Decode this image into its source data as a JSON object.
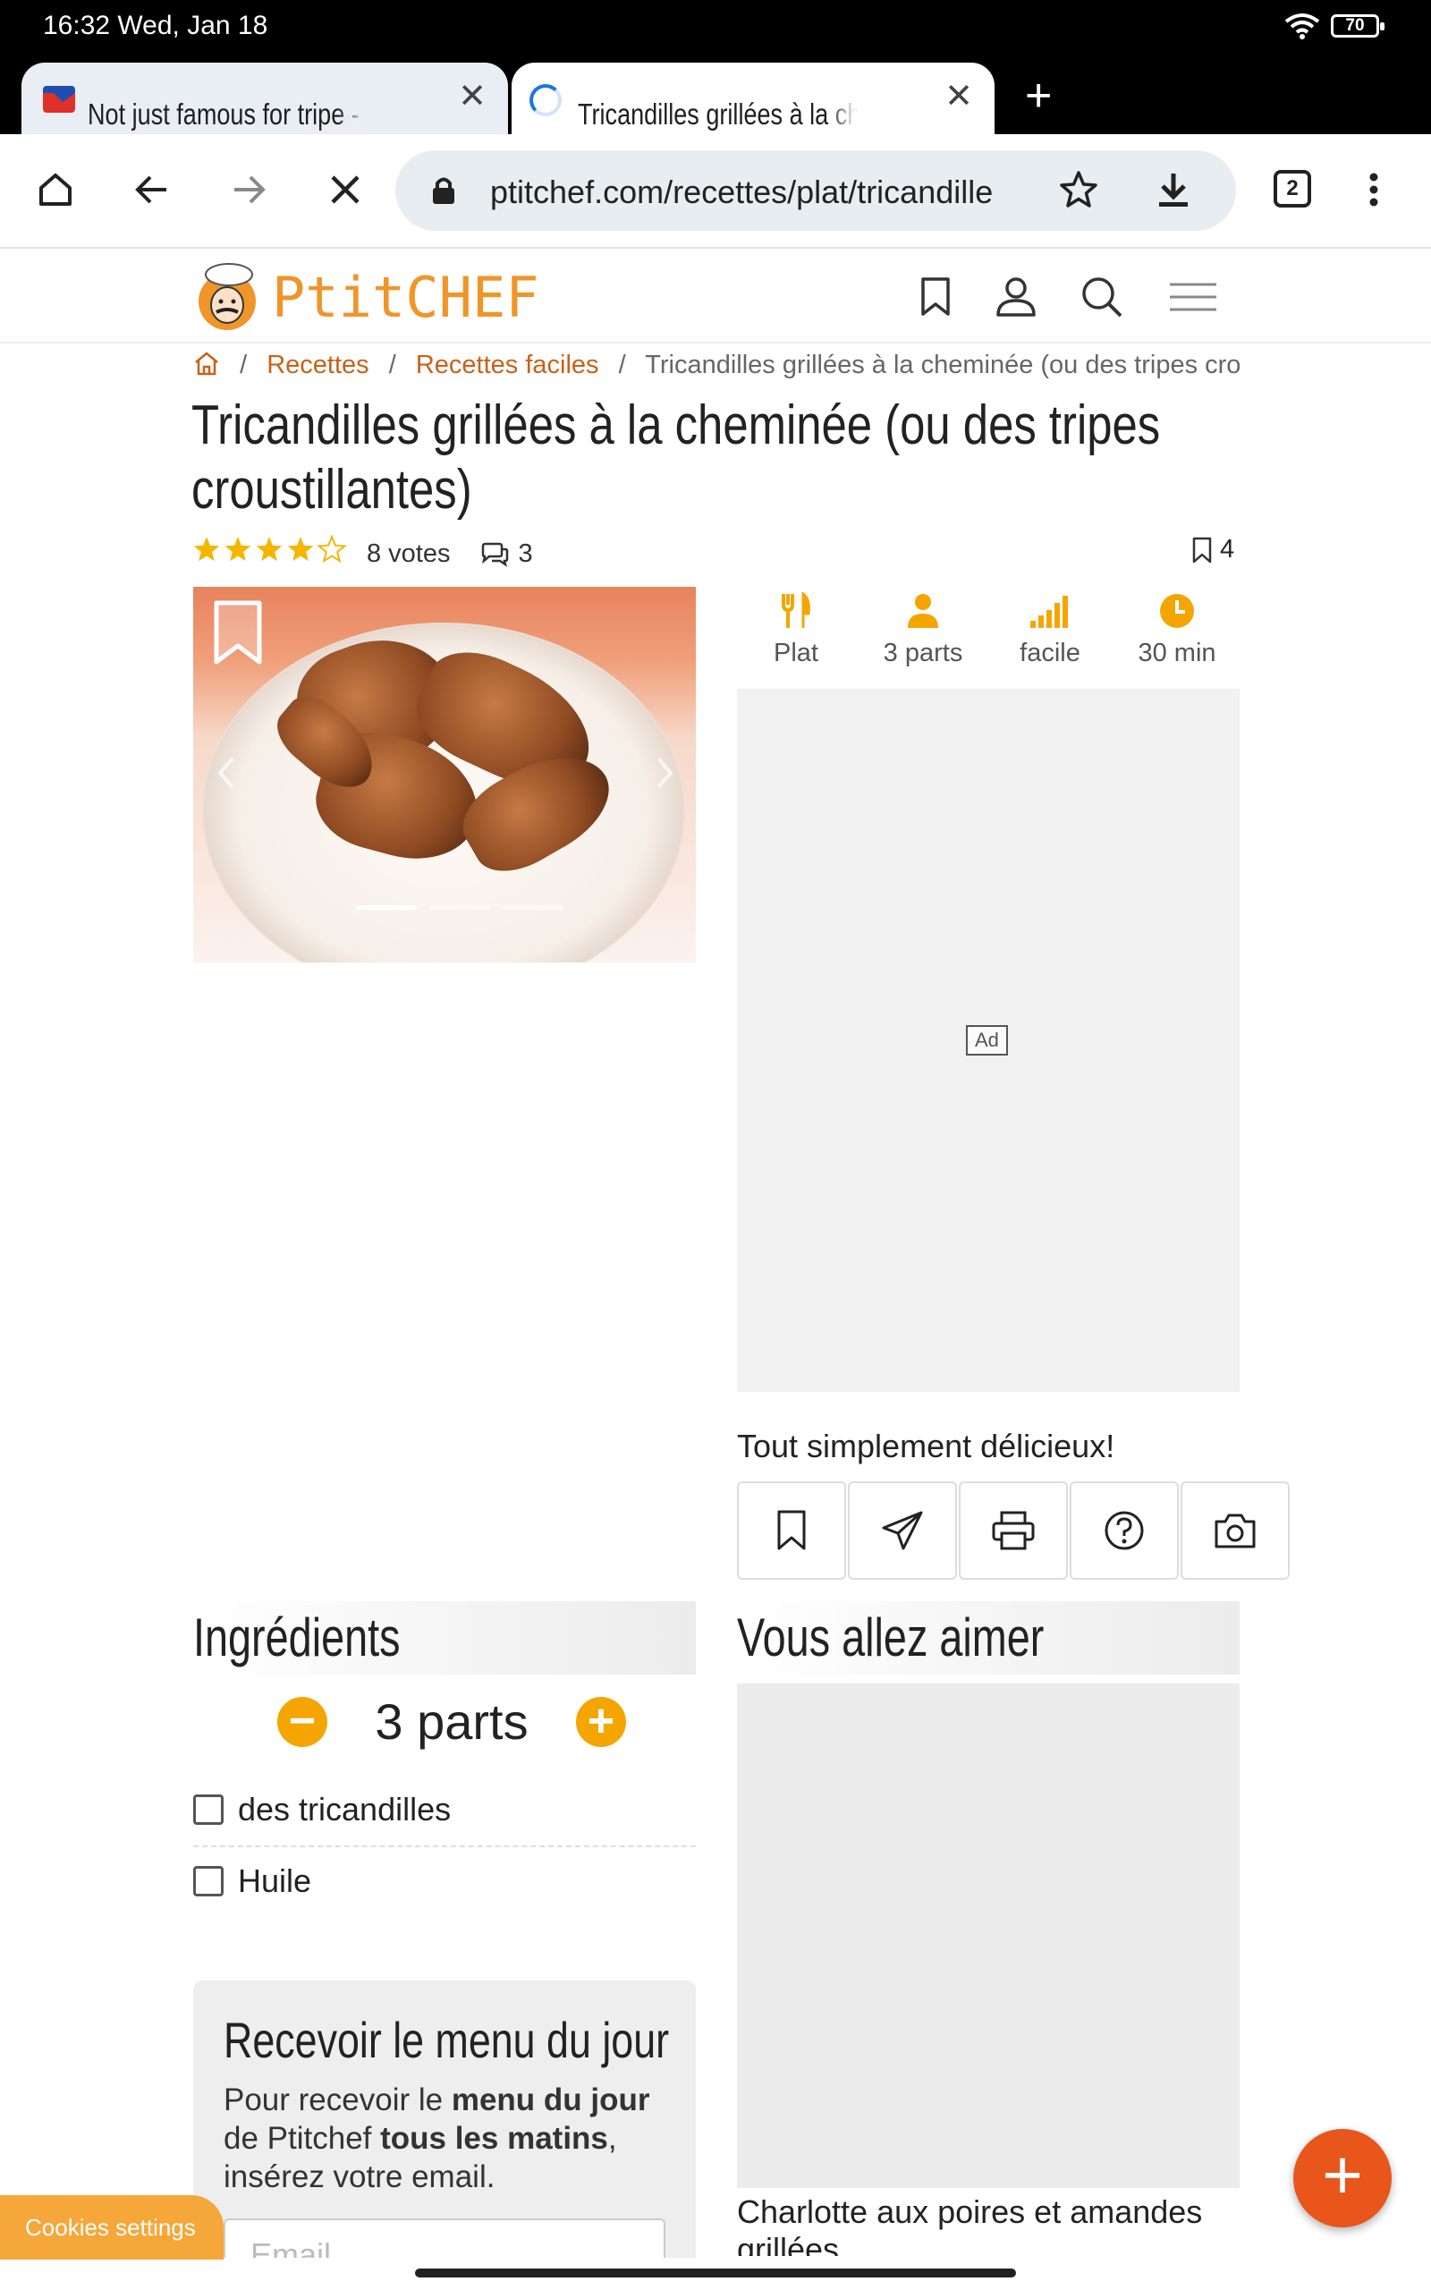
{
  "status_bar": {
    "time": "16:32  Wed, Jan 18",
    "battery": "70"
  },
  "tabs": [
    {
      "title": "Not just famous for tripe - Cult"
    },
    {
      "title": "Tricandilles grillées à la chemin"
    }
  ],
  "address_bar": {
    "url": "ptitchef.com/recettes/plat/tricandille",
    "tab_count": "2"
  },
  "site": {
    "brand": "PtitCHEF"
  },
  "breadcrumb": {
    "items": [
      "Recettes",
      "Recettes faciles"
    ],
    "current": "Tricandilles grillées à la cheminée (ou des tripes crou"
  },
  "recipe": {
    "title": "Tricandilles grillées à la cheminée (ou des tripes croustillantes)",
    "rating": 4,
    "votes": "8 votes",
    "comments": "3",
    "saves": "4",
    "meta": {
      "category": "Plat",
      "servings": "3 parts",
      "difficulty": "facile",
      "time": "30 min"
    },
    "ad_label": "Ad",
    "tagline": "Tout simplement délicieux!"
  },
  "ingredients": {
    "heading": "Ingrédients",
    "servings": "3 parts",
    "items": [
      "des tricandilles",
      "Huile"
    ]
  },
  "newsletter": {
    "title": "Recevoir le menu du jour",
    "text_parts": [
      "Pour recevoir le ",
      "menu du jour",
      " de Ptitchef ",
      "tous les matins",
      ", insérez votre email."
    ],
    "placeholder": "Email"
  },
  "recommendations": {
    "heading": "Vous allez aimer",
    "first_title": "Charlotte aux poires et amandes grillées"
  },
  "cookies": {
    "label": "Cookies settings"
  },
  "colors": {
    "accent": "#f0952a",
    "link": "#c8611a",
    "fab": "#e8561b",
    "star": "#f5b500"
  }
}
